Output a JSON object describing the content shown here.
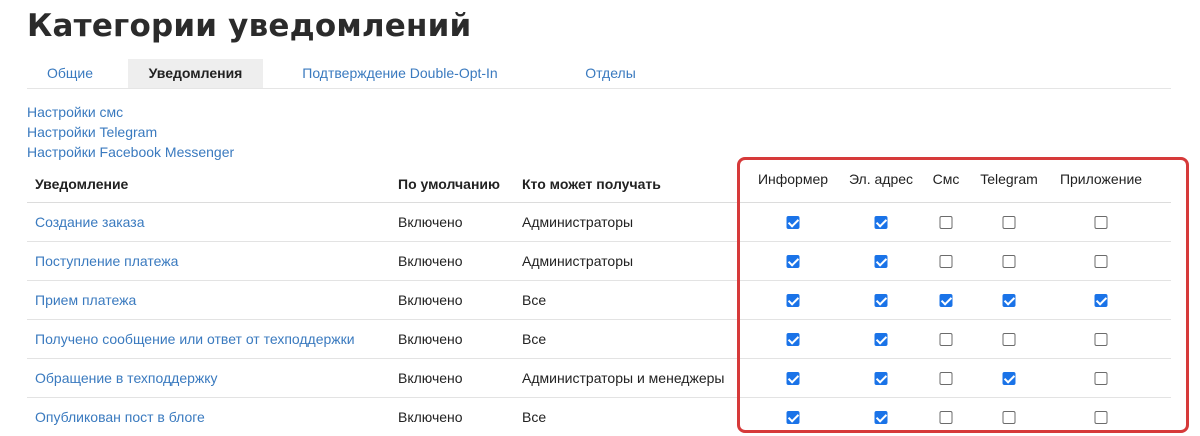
{
  "page_title": "Категории уведомлений",
  "tabs": [
    {
      "label": "Общие",
      "active": false
    },
    {
      "label": "Уведомления",
      "active": true
    },
    {
      "label": "Подтверждение Double-Opt-In",
      "active": false
    },
    {
      "label": "Отделы",
      "active": false
    }
  ],
  "settings_links": [
    "Настройки смс",
    "Настройки Telegram",
    "Настройки Facebook Messenger"
  ],
  "table": {
    "headers": {
      "notification": "Уведомление",
      "default": "По умолчанию",
      "recipients": "Кто может получать"
    },
    "channels": [
      "Информер",
      "Эл. адрес",
      "Смс",
      "Telegram",
      "Приложение"
    ],
    "rows": [
      {
        "name": "Создание заказа",
        "default": "Включено",
        "recipients": "Администраторы",
        "channels": [
          true,
          true,
          false,
          false,
          false
        ]
      },
      {
        "name": "Поступление платежа",
        "default": "Включено",
        "recipients": "Администраторы",
        "channels": [
          true,
          true,
          false,
          false,
          false
        ]
      },
      {
        "name": "Прием платежа",
        "default": "Включено",
        "recipients": "Все",
        "channels": [
          true,
          true,
          true,
          true,
          true
        ]
      },
      {
        "name": "Получено сообщение или ответ от техподдержки",
        "default": "Включено",
        "recipients": "Все",
        "channels": [
          true,
          true,
          false,
          false,
          false
        ]
      },
      {
        "name": "Обращение в техподдержку",
        "default": "Включено",
        "recipients": "Администраторы и менеджеры",
        "channels": [
          true,
          true,
          false,
          true,
          false
        ]
      },
      {
        "name": "Опубликован пост в блоге",
        "default": "Включено",
        "recipients": "Все",
        "channels": [
          true,
          true,
          false,
          false,
          false
        ]
      }
    ]
  },
  "colors": {
    "link": "#3a7abf",
    "checkbox_checked": "#1a73e8",
    "highlight": "#d63a3a",
    "active_tab_bg": "#eeeeee"
  }
}
